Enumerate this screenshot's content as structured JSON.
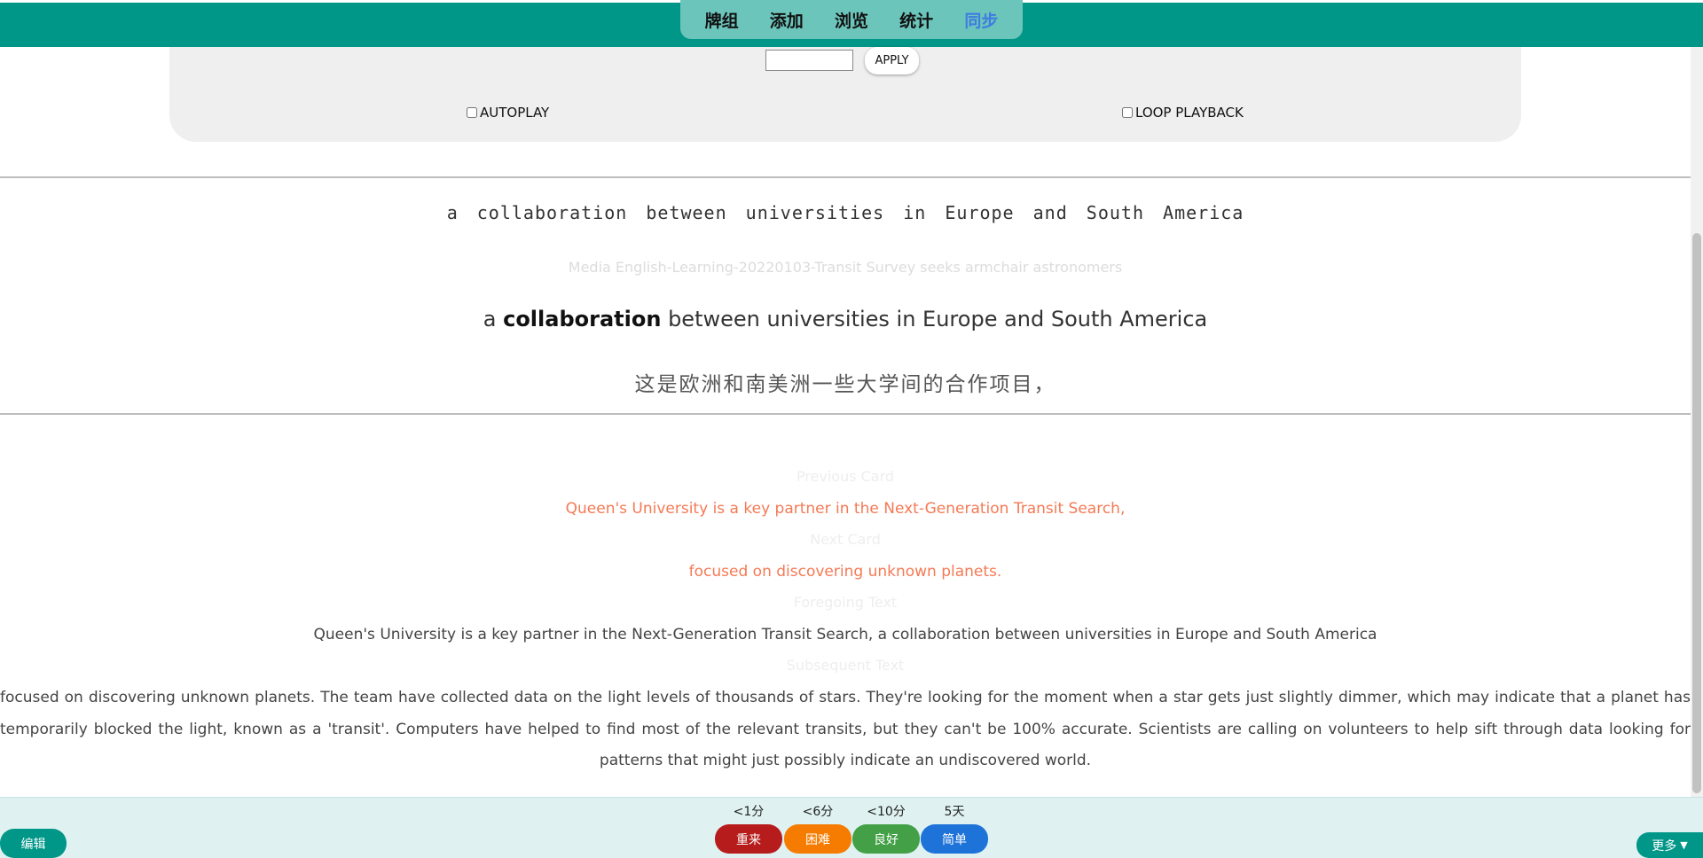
{
  "nav": {
    "tabs": [
      {
        "label": "牌组"
      },
      {
        "label": "添加"
      },
      {
        "label": "浏览"
      },
      {
        "label": "统计"
      },
      {
        "label": "同步"
      }
    ],
    "active_tab": "同步"
  },
  "controls": {
    "apply_label": "APPLY",
    "apply_input_value": "",
    "autoplay_label": "AUTOPLAY",
    "autoplay_checked": false,
    "loop_label": "LOOP PLAYBACK",
    "loop_checked": false
  },
  "card": {
    "sentence_mono": "a collaboration between universities in Europe and South America",
    "source": "Media English-Learning-20220103-Transit Survey seeks armchair astronomers",
    "sentence_before": "a ",
    "keyword": "collaboration",
    "sentence_after": " between universities in Europe and South America",
    "translation": "这是欧洲和南美洲一些大学间的合作项目，"
  },
  "context": {
    "previous_card_label": "Previous Card",
    "previous_card_text": "Queen's University is a key partner in the Next-Generation Transit Search,",
    "next_card_label": "Next Card",
    "next_card_text": "focused on discovering unknown planets.",
    "foregoing_label": "Foregoing Text",
    "foregoing_text": "Queen's University is a key partner in the Next-Generation Transit Search, a collaboration between universities in Europe and South America",
    "subsequent_label": "Subsequent Text",
    "subsequent_text": "focused on discovering unknown planets. The team have collected data on the light levels of thousands of stars. They're looking for the moment when a star gets just slightly dimmer, which may indicate that a planet has temporarily blocked the light, known as a 'transit'. Computers have helped to find most of the relevant transits, but they can't be 100% accurate. Scientists are calling on volunteers to help sift through data looking for patterns that might just possibly indicate an undiscovered world."
  },
  "answers": [
    {
      "interval": "<1分",
      "label": "重来",
      "color": "#b71c1c"
    },
    {
      "interval": "<6分",
      "label": "困难",
      "color": "#f57c00"
    },
    {
      "interval": "<10分",
      "label": "良好",
      "color": "#43a047"
    },
    {
      "interval": "5天",
      "label": "简单",
      "color": "#1e73d8"
    }
  ],
  "footer": {
    "edit_label": "编辑",
    "more_label": "更多",
    "more_icon": "▼"
  },
  "colors": {
    "accent": "#009688",
    "active_tab": "#3f7ce0",
    "context_highlight": "#f47a55"
  }
}
